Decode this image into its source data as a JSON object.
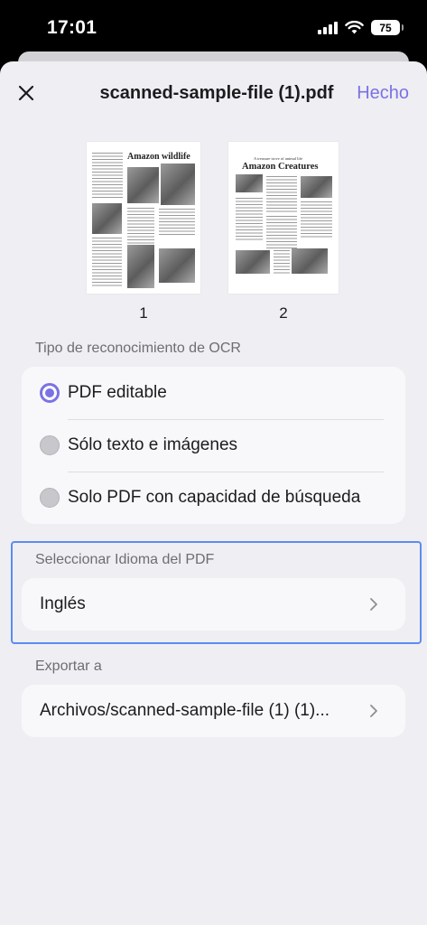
{
  "status_bar": {
    "time": "17:01",
    "battery": "75"
  },
  "header": {
    "title": "scanned-sample-file (1).pdf",
    "done_label": "Hecho"
  },
  "pages": [
    {
      "number": "1",
      "title": "Amazon wildlife"
    },
    {
      "number": "2",
      "subtitle": "A treasure trove of animal life",
      "title": "Amazon Creatures"
    }
  ],
  "ocr": {
    "section_label": "Tipo de reconocimiento de OCR",
    "options": [
      {
        "label": "PDF editable",
        "selected": true
      },
      {
        "label": "Sólo texto e imágenes",
        "selected": false
      },
      {
        "label": "Solo PDF con capacidad de búsqueda",
        "selected": false
      }
    ]
  },
  "language": {
    "section_label": "Seleccionar Idioma del PDF",
    "value": "Inglés"
  },
  "export": {
    "section_label": "Exportar a",
    "value": "Archivos/scanned-sample-file (1) (1)..."
  },
  "colors": {
    "accent": "#7b72e4",
    "focus_border": "#5b8cf0",
    "sheet_bg": "#efeef3"
  }
}
